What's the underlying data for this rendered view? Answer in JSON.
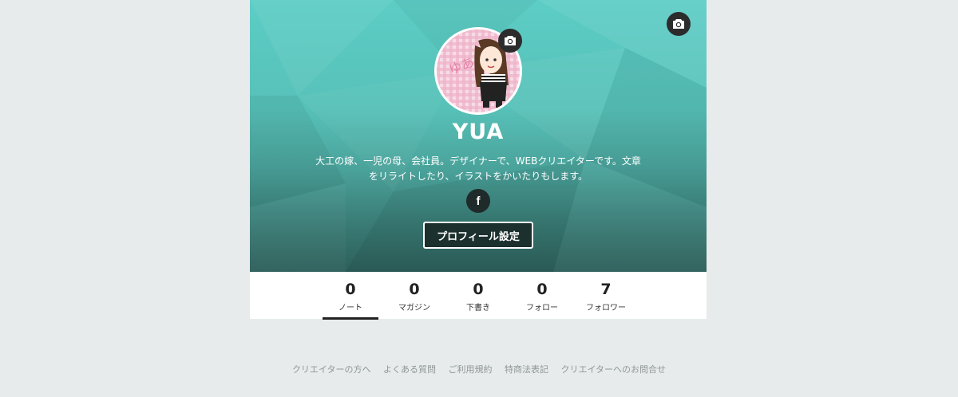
{
  "profile": {
    "name": "YUA",
    "bio_line1": "大工の嫁、一児の母、会社員。デザイナーで、WEBクリエイターです。文章",
    "bio_line2": "をリライトしたり、イラストをかいたりもします。",
    "facebook_glyph": "f",
    "settings_button": "プロフィール設定"
  },
  "stats": [
    {
      "count": "0",
      "label": "ノート"
    },
    {
      "count": "0",
      "label": "マガジン"
    },
    {
      "count": "0",
      "label": "下書き"
    },
    {
      "count": "0",
      "label": "フォロー"
    },
    {
      "count": "7",
      "label": "フォロワー"
    }
  ],
  "footer_links": [
    "クリエイターの方へ",
    "よくある質問",
    "ご利用規約",
    "特商法表記",
    "クリエイターへのお問合せ"
  ],
  "icons": {
    "cover_camera": "camera-icon",
    "avatar_camera": "camera-icon",
    "facebook": "facebook-icon"
  },
  "colors": {
    "cover_top": "#5ccdc5",
    "cover_bottom": "#2d5f5a",
    "page_bg": "#e7ebeb",
    "button_bg": "#1c302e"
  }
}
